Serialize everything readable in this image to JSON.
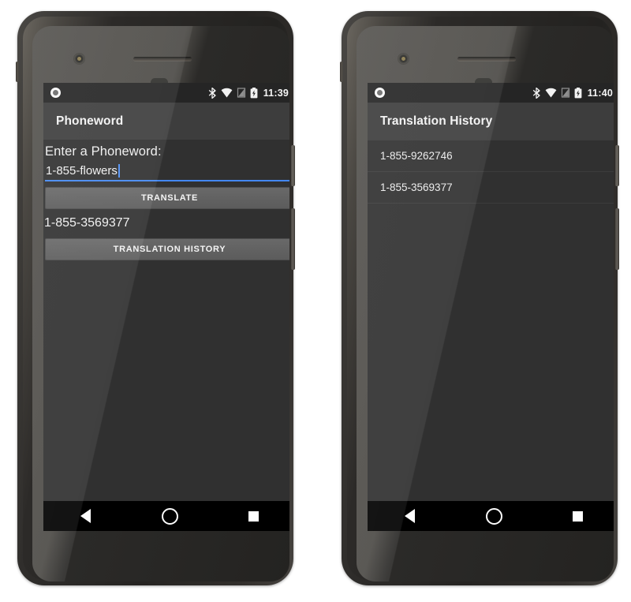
{
  "devices": [
    {
      "name": "phoneword-device",
      "status_bar": {
        "time": "11:39",
        "icons": [
          "bluetooth-icon",
          "wifi-icon",
          "no-sim-icon",
          "battery-icon"
        ],
        "notification_icon": "record-dot-icon"
      },
      "app_bar": {
        "title": "Phoneword"
      },
      "screen_type": "phoneword",
      "content": {
        "label": "Enter a Phoneword:",
        "input_value": "1-855-flowers",
        "input_placeholder": "1-855-flowers",
        "translate_button": "TRANSLATE",
        "result": "1-855-3569377",
        "history_button": "TRANSLATION HISTORY",
        "underline_color": "#4488f4"
      },
      "nav_bar": {
        "back": "back-icon",
        "home": "home-icon",
        "recents": "recents-icon"
      }
    },
    {
      "name": "history-device",
      "status_bar": {
        "time": "11:40",
        "icons": [
          "bluetooth-icon",
          "wifi-icon",
          "no-sim-icon",
          "battery-icon"
        ],
        "notification_icon": "record-dot-icon"
      },
      "app_bar": {
        "title": "Translation History"
      },
      "screen_type": "history",
      "content": {
        "items": [
          "1-855-9262746",
          "1-855-3569377"
        ]
      },
      "nav_bar": {
        "back": "back-icon",
        "home": "home-icon",
        "recents": "recents-icon"
      }
    }
  ],
  "theme": {
    "page_background": "#ffffff",
    "screen_background": "#303030",
    "app_bar_background": "#3d3d3d",
    "status_bar_background": "#252525",
    "nav_bar_background": "#000000",
    "accent": "#4488f4",
    "button_background": "#626262",
    "text_primary": "#f0f0f0"
  }
}
